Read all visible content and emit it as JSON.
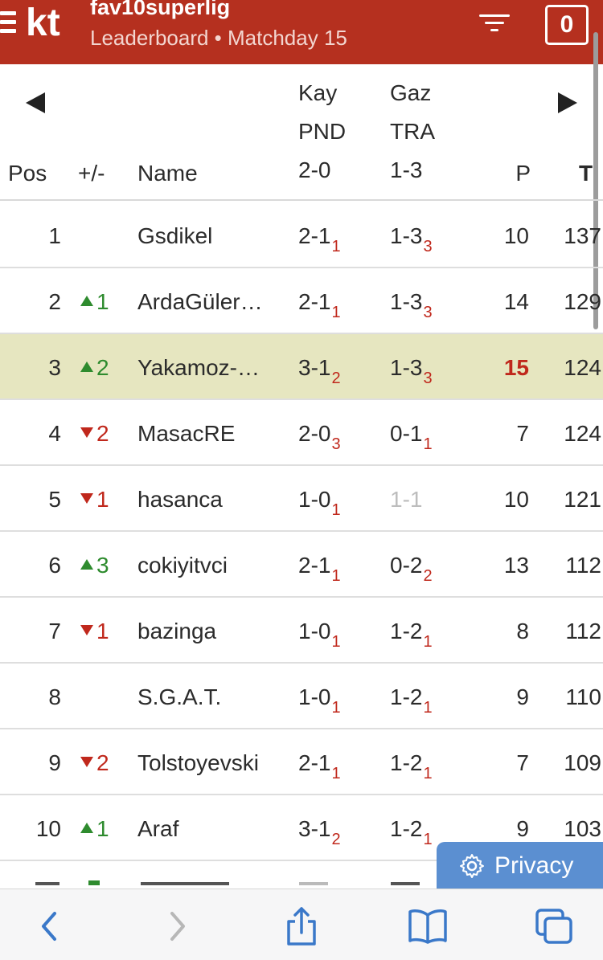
{
  "header": {
    "logo": "kt",
    "title": "fav10superlig",
    "subtitle": "Leaderboard • Matchday 15",
    "count": "0"
  },
  "table": {
    "columns": {
      "pos": "Pos",
      "change": "+/-",
      "name": "Name",
      "p": "P",
      "t": "T"
    },
    "matches": [
      {
        "home": "Kay",
        "away": "PND",
        "score": "2-0"
      },
      {
        "home": "Gaz",
        "away": "TRA",
        "score": "1-3"
      }
    ],
    "rows": [
      {
        "pos": "1",
        "dir": "",
        "chg": "",
        "name": "Gsdikel",
        "m1": "2-1",
        "m1p": "1",
        "m2": "1-3",
        "m2p": "3",
        "p": "10",
        "t": "137"
      },
      {
        "pos": "2",
        "dir": "up",
        "chg": "1",
        "name": "ArdaGüler…",
        "m1": "2-1",
        "m1p": "1",
        "m2": "1-3",
        "m2p": "3",
        "p": "14",
        "t": "129"
      },
      {
        "pos": "3",
        "dir": "up",
        "chg": "2",
        "name": "Yakamoz-…",
        "m1": "3-1",
        "m1p": "2",
        "m2": "1-3",
        "m2p": "3",
        "p": "15",
        "t": "124",
        "highlight": true
      },
      {
        "pos": "4",
        "dir": "down",
        "chg": "2",
        "name": "MasacRE",
        "m1": "2-0",
        "m1p": "3",
        "m2": "0-1",
        "m2p": "1",
        "p": "7",
        "t": "124"
      },
      {
        "pos": "5",
        "dir": "down",
        "chg": "1",
        "name": "hasanca",
        "m1": "1-0",
        "m1p": "1",
        "m2": "1-1",
        "m2p": "",
        "p": "10",
        "t": "121"
      },
      {
        "pos": "6",
        "dir": "up",
        "chg": "3",
        "name": "cokiyitvci",
        "m1": "2-1",
        "m1p": "1",
        "m2": "0-2",
        "m2p": "2",
        "p": "13",
        "t": "112"
      },
      {
        "pos": "7",
        "dir": "down",
        "chg": "1",
        "name": "bazinga",
        "m1": "1-0",
        "m1p": "1",
        "m2": "1-2",
        "m2p": "1",
        "p": "8",
        "t": "112"
      },
      {
        "pos": "8",
        "dir": "",
        "chg": "",
        "name": "S.G.A.T.",
        "m1": "1-0",
        "m1p": "1",
        "m2": "1-2",
        "m2p": "1",
        "p": "9",
        "t": "110"
      },
      {
        "pos": "9",
        "dir": "down",
        "chg": "2",
        "name": "Tolstoyevski",
        "m1": "2-1",
        "m1p": "1",
        "m2": "1-2",
        "m2p": "1",
        "p": "7",
        "t": "109"
      },
      {
        "pos": "10",
        "dir": "up",
        "chg": "1",
        "name": "Araf",
        "m1": "3-1",
        "m1p": "2",
        "m2": "1-2",
        "m2p": "1",
        "p": "9",
        "t": "103"
      }
    ]
  },
  "privacy": {
    "label": "Privacy"
  },
  "colors": {
    "header_bg": "#b5301f",
    "highlight_row": "#e6e6c0",
    "accent_blue": "#3a78c9",
    "up": "#2e8b2e",
    "down": "#c0281c"
  },
  "browser": {
    "icons": [
      "back-icon",
      "forward-icon",
      "share-icon",
      "bookmarks-icon",
      "tabs-icon"
    ]
  }
}
